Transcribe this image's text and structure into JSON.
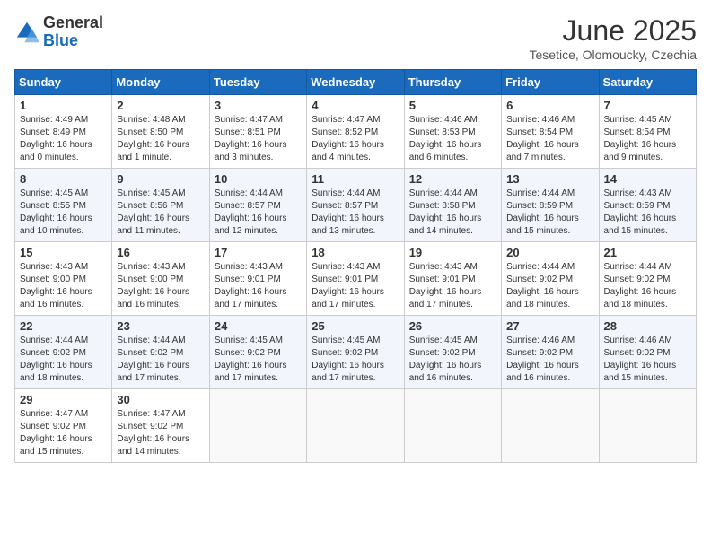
{
  "logo": {
    "general": "General",
    "blue": "Blue"
  },
  "title": {
    "month_year": "June 2025",
    "location": "Tesetice, Olomoucky, Czechia"
  },
  "weekdays": [
    "Sunday",
    "Monday",
    "Tuesday",
    "Wednesday",
    "Thursday",
    "Friday",
    "Saturday"
  ],
  "weeks": [
    [
      {
        "day": "1",
        "sunrise": "Sunrise: 4:49 AM",
        "sunset": "Sunset: 8:49 PM",
        "daylight": "Daylight: 16 hours and 0 minutes."
      },
      {
        "day": "2",
        "sunrise": "Sunrise: 4:48 AM",
        "sunset": "Sunset: 8:50 PM",
        "daylight": "Daylight: 16 hours and 1 minute."
      },
      {
        "day": "3",
        "sunrise": "Sunrise: 4:47 AM",
        "sunset": "Sunset: 8:51 PM",
        "daylight": "Daylight: 16 hours and 3 minutes."
      },
      {
        "day": "4",
        "sunrise": "Sunrise: 4:47 AM",
        "sunset": "Sunset: 8:52 PM",
        "daylight": "Daylight: 16 hours and 4 minutes."
      },
      {
        "day": "5",
        "sunrise": "Sunrise: 4:46 AM",
        "sunset": "Sunset: 8:53 PM",
        "daylight": "Daylight: 16 hours and 6 minutes."
      },
      {
        "day": "6",
        "sunrise": "Sunrise: 4:46 AM",
        "sunset": "Sunset: 8:54 PM",
        "daylight": "Daylight: 16 hours and 7 minutes."
      },
      {
        "day": "7",
        "sunrise": "Sunrise: 4:45 AM",
        "sunset": "Sunset: 8:54 PM",
        "daylight": "Daylight: 16 hours and 9 minutes."
      }
    ],
    [
      {
        "day": "8",
        "sunrise": "Sunrise: 4:45 AM",
        "sunset": "Sunset: 8:55 PM",
        "daylight": "Daylight: 16 hours and 10 minutes."
      },
      {
        "day": "9",
        "sunrise": "Sunrise: 4:45 AM",
        "sunset": "Sunset: 8:56 PM",
        "daylight": "Daylight: 16 hours and 11 minutes."
      },
      {
        "day": "10",
        "sunrise": "Sunrise: 4:44 AM",
        "sunset": "Sunset: 8:57 PM",
        "daylight": "Daylight: 16 hours and 12 minutes."
      },
      {
        "day": "11",
        "sunrise": "Sunrise: 4:44 AM",
        "sunset": "Sunset: 8:57 PM",
        "daylight": "Daylight: 16 hours and 13 minutes."
      },
      {
        "day": "12",
        "sunrise": "Sunrise: 4:44 AM",
        "sunset": "Sunset: 8:58 PM",
        "daylight": "Daylight: 16 hours and 14 minutes."
      },
      {
        "day": "13",
        "sunrise": "Sunrise: 4:44 AM",
        "sunset": "Sunset: 8:59 PM",
        "daylight": "Daylight: 16 hours and 15 minutes."
      },
      {
        "day": "14",
        "sunrise": "Sunrise: 4:43 AM",
        "sunset": "Sunset: 8:59 PM",
        "daylight": "Daylight: 16 hours and 15 minutes."
      }
    ],
    [
      {
        "day": "15",
        "sunrise": "Sunrise: 4:43 AM",
        "sunset": "Sunset: 9:00 PM",
        "daylight": "Daylight: 16 hours and 16 minutes."
      },
      {
        "day": "16",
        "sunrise": "Sunrise: 4:43 AM",
        "sunset": "Sunset: 9:00 PM",
        "daylight": "Daylight: 16 hours and 16 minutes."
      },
      {
        "day": "17",
        "sunrise": "Sunrise: 4:43 AM",
        "sunset": "Sunset: 9:01 PM",
        "daylight": "Daylight: 16 hours and 17 minutes."
      },
      {
        "day": "18",
        "sunrise": "Sunrise: 4:43 AM",
        "sunset": "Sunset: 9:01 PM",
        "daylight": "Daylight: 16 hours and 17 minutes."
      },
      {
        "day": "19",
        "sunrise": "Sunrise: 4:43 AM",
        "sunset": "Sunset: 9:01 PM",
        "daylight": "Daylight: 16 hours and 17 minutes."
      },
      {
        "day": "20",
        "sunrise": "Sunrise: 4:44 AM",
        "sunset": "Sunset: 9:02 PM",
        "daylight": "Daylight: 16 hours and 18 minutes."
      },
      {
        "day": "21",
        "sunrise": "Sunrise: 4:44 AM",
        "sunset": "Sunset: 9:02 PM",
        "daylight": "Daylight: 16 hours and 18 minutes."
      }
    ],
    [
      {
        "day": "22",
        "sunrise": "Sunrise: 4:44 AM",
        "sunset": "Sunset: 9:02 PM",
        "daylight": "Daylight: 16 hours and 18 minutes."
      },
      {
        "day": "23",
        "sunrise": "Sunrise: 4:44 AM",
        "sunset": "Sunset: 9:02 PM",
        "daylight": "Daylight: 16 hours and 17 minutes."
      },
      {
        "day": "24",
        "sunrise": "Sunrise: 4:45 AM",
        "sunset": "Sunset: 9:02 PM",
        "daylight": "Daylight: 16 hours and 17 minutes."
      },
      {
        "day": "25",
        "sunrise": "Sunrise: 4:45 AM",
        "sunset": "Sunset: 9:02 PM",
        "daylight": "Daylight: 16 hours and 17 minutes."
      },
      {
        "day": "26",
        "sunrise": "Sunrise: 4:45 AM",
        "sunset": "Sunset: 9:02 PM",
        "daylight": "Daylight: 16 hours and 16 minutes."
      },
      {
        "day": "27",
        "sunrise": "Sunrise: 4:46 AM",
        "sunset": "Sunset: 9:02 PM",
        "daylight": "Daylight: 16 hours and 16 minutes."
      },
      {
        "day": "28",
        "sunrise": "Sunrise: 4:46 AM",
        "sunset": "Sunset: 9:02 PM",
        "daylight": "Daylight: 16 hours and 15 minutes."
      }
    ],
    [
      {
        "day": "29",
        "sunrise": "Sunrise: 4:47 AM",
        "sunset": "Sunset: 9:02 PM",
        "daylight": "Daylight: 16 hours and 15 minutes."
      },
      {
        "day": "30",
        "sunrise": "Sunrise: 4:47 AM",
        "sunset": "Sunset: 9:02 PM",
        "daylight": "Daylight: 16 hours and 14 minutes."
      },
      null,
      null,
      null,
      null,
      null
    ]
  ]
}
